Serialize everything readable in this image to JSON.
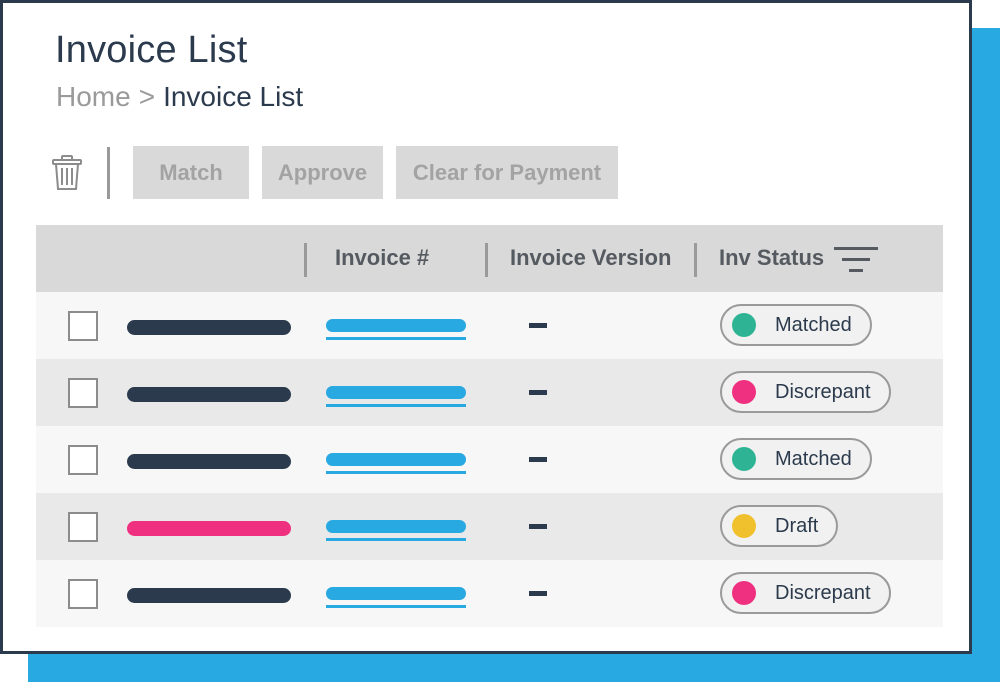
{
  "header": {
    "title": "Invoice List",
    "breadcrumb": {
      "home": "Home",
      "separator": ">",
      "current": "Invoice List"
    }
  },
  "toolbar": {
    "delete_icon": "trash-icon",
    "buttons": [
      {
        "label": "Match"
      },
      {
        "label": "Approve"
      },
      {
        "label": "Clear for Payment"
      }
    ]
  },
  "table": {
    "columns": [
      "Invoice #",
      "Invoice Version",
      "Inv Status"
    ],
    "filter_icon": "filter-icon",
    "rows": [
      {
        "version": "–",
        "status": "Matched",
        "status_color": "#2eb494",
        "name_color": "#2b3a4c"
      },
      {
        "version": "–",
        "status": "Discrepant",
        "status_color": "#ef2f7f",
        "name_color": "#2b3a4c"
      },
      {
        "version": "–",
        "status": "Matched",
        "status_color": "#2eb494",
        "name_color": "#2b3a4c"
      },
      {
        "version": "–",
        "status": "Draft",
        "status_color": "#f0c12d",
        "name_color": "#ef2f7f"
      },
      {
        "version": "–",
        "status": "Discrepant",
        "status_color": "#ef2f7f",
        "name_color": "#2b3a4c"
      }
    ]
  },
  "colors": {
    "accent": "#29a9e1",
    "frame": "#2b3a4c",
    "matched": "#2eb494",
    "discrepant": "#ef2f7f",
    "draft": "#f0c12d"
  }
}
